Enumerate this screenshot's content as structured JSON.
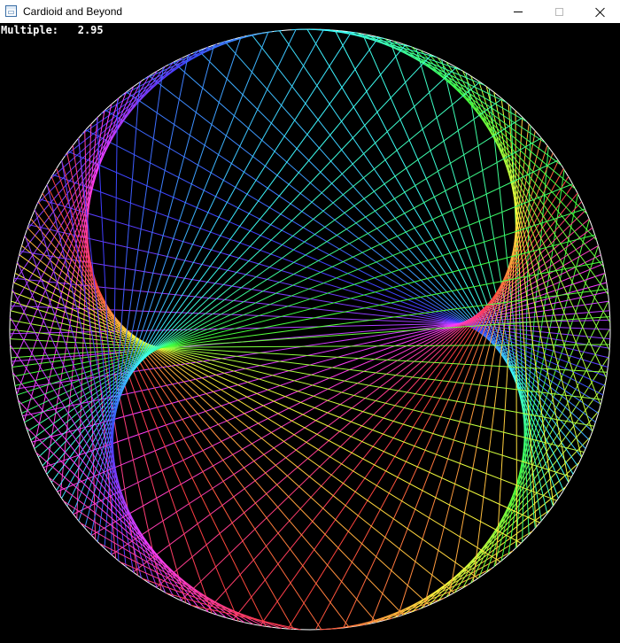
{
  "window": {
    "title": "Cardioid and Beyond",
    "icons": {
      "app": "app-window-icon",
      "minimize": "minimize-icon",
      "maximize": "maximize-icon",
      "close": "close-icon"
    }
  },
  "readout": {
    "label": "Multiple:",
    "value": "2.95"
  },
  "canvas": {
    "background": "#000000",
    "circle_color": "#ffffff",
    "multiplier": 2.95,
    "point_count": 200,
    "color_cycle": "rainbow-hue"
  }
}
